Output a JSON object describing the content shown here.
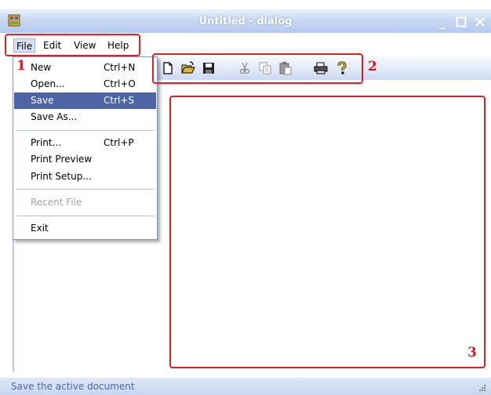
{
  "window": {
    "title": "Untitled - dialog",
    "controls": [
      "minimize-icon",
      "maximize-icon",
      "close-icon"
    ]
  },
  "menubar": {
    "items": [
      {
        "label": "File"
      },
      {
        "label": "Edit"
      },
      {
        "label": "View"
      },
      {
        "label": "Help"
      }
    ]
  },
  "file_menu": {
    "items": [
      {
        "label": "New",
        "shortcut": "Ctrl+N"
      },
      {
        "label": "Open...",
        "shortcut": "Ctrl+O"
      },
      {
        "label": "Save",
        "shortcut": "Ctrl+S",
        "selected": true
      },
      {
        "label": "Save As...",
        "shortcut": ""
      },
      {
        "label": "Print...",
        "shortcut": "Ctrl+P"
      },
      {
        "label": "Print Preview",
        "shortcut": ""
      },
      {
        "label": "Print Setup...",
        "shortcut": ""
      },
      {
        "label": "Recent File",
        "shortcut": "",
        "disabled": true
      },
      {
        "label": "Exit",
        "shortcut": ""
      }
    ]
  },
  "toolbar": {
    "icons": [
      "new-file-icon",
      "open-folder-icon",
      "save-disk-icon",
      "cut-icon",
      "copy-icon",
      "paste-icon",
      "print-icon",
      "help-icon"
    ]
  },
  "statusbar": {
    "text": "Save the active document"
  },
  "annotations": {
    "label_1": "1",
    "label_2": "2",
    "label_3": "3",
    "color": "#e02020"
  }
}
